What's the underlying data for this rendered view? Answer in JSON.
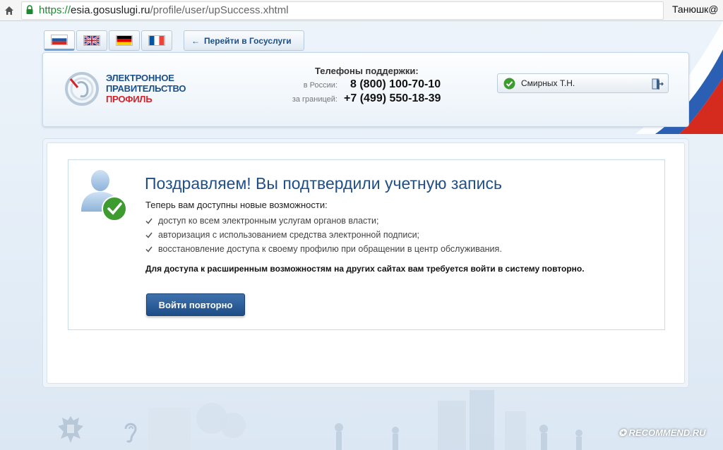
{
  "browser": {
    "url_scheme": "https://",
    "url_host": "esia.gosuslugi.ru",
    "url_path": "/profile/user/upSuccess.xhtml",
    "user_label": "Танюшк@"
  },
  "languages": [
    {
      "code": "ru",
      "icon": "flag-russia-icon",
      "active": true
    },
    {
      "code": "en",
      "icon": "flag-uk-icon",
      "active": false
    },
    {
      "code": "de",
      "icon": "flag-germany-icon",
      "active": false
    },
    {
      "code": "fr",
      "icon": "flag-france-icon",
      "active": false
    }
  ],
  "header": {
    "back_label": "Перейти в Госуслуги",
    "logo_line1": "ЭЛЕКТРОННОЕ",
    "logo_line2": "ПРАВИТЕЛЬСТВО",
    "logo_line3": "ПРОФИЛЬ",
    "support_title": "Телефоны поддержки:",
    "phone_ru_label": "в России:",
    "phone_ru": "8 (800) 100-70-10",
    "phone_abroad_label": "за границей:",
    "phone_abroad": "+7 (499) 550-18-39",
    "user_name": "Смирных Т.Н."
  },
  "success": {
    "title": "Поздравляем! Вы подтвердили учетную запись",
    "lead": "Теперь вам доступны новые возможности:",
    "features": [
      "доступ ко всем электронным услугам органов власти;",
      "авторизация с использованием средства электронной подписи;",
      "восстановление доступа к своему профилю при обращении в центр обслуживания."
    ],
    "note": "Для доступа к расширенным возможностям на других сайтах вам требуется войти в систему повторно.",
    "button_label": "Войти повторно"
  },
  "footer": {
    "watermark": "✪ RECOMMEND.RU"
  },
  "colors": {
    "brand_blue": "#1f4f86",
    "button_blue": "#1e4d87",
    "success_green": "#3e9b2f",
    "accent_red": "#d2232a"
  }
}
